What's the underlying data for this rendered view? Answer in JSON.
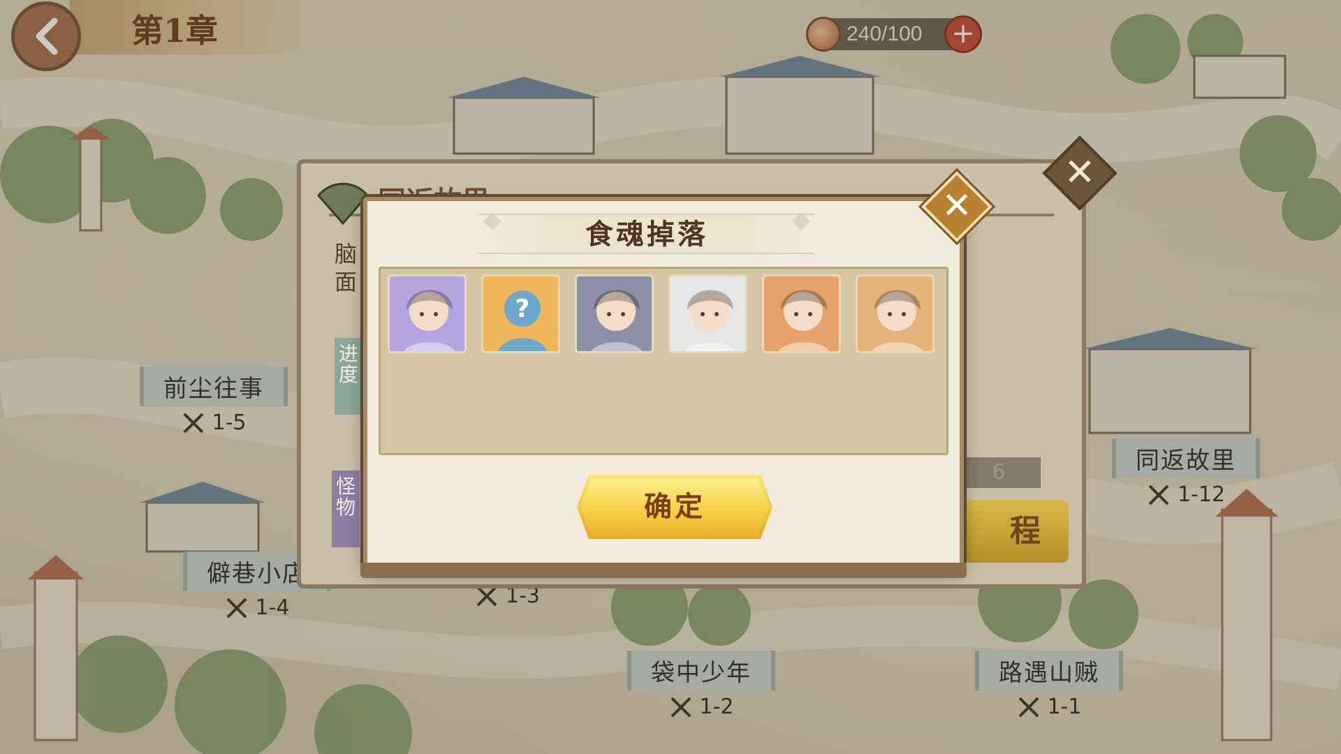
{
  "header": {
    "chapter_title": "第1章",
    "stamina": "240/100"
  },
  "stages": [
    {
      "name": "前尘往事",
      "code": "1-5"
    },
    {
      "name": "僻巷小店",
      "code": "1-4"
    },
    {
      "name": "",
      "code": "1-3"
    },
    {
      "name": "袋中少年",
      "code": "1-2"
    },
    {
      "name": "路遇山贼",
      "code": "1-1"
    },
    {
      "name": "同返故里",
      "code": "1-12"
    }
  ],
  "back_panel": {
    "title": "同返故里",
    "desc_line1": "脑",
    "desc_line2": "面",
    "tab_progress": "进度",
    "tab_monster": "怪物",
    "count": "6",
    "start_label": "程"
  },
  "modal": {
    "title": "食魂掉落",
    "confirm_label": "确定",
    "rewards": [
      {
        "name": "blonde-character",
        "color": "#b6a4e0"
      },
      {
        "name": "unknown-character",
        "color": "#f0b75a"
      },
      {
        "name": "grey-character",
        "color": "#8f8fa8"
      },
      {
        "name": "black-hair-character",
        "color": "#e6e6e6"
      },
      {
        "name": "white-hair-character",
        "color": "#e6a26a"
      },
      {
        "name": "green-hair-character",
        "color": "#e7b37d"
      }
    ]
  }
}
